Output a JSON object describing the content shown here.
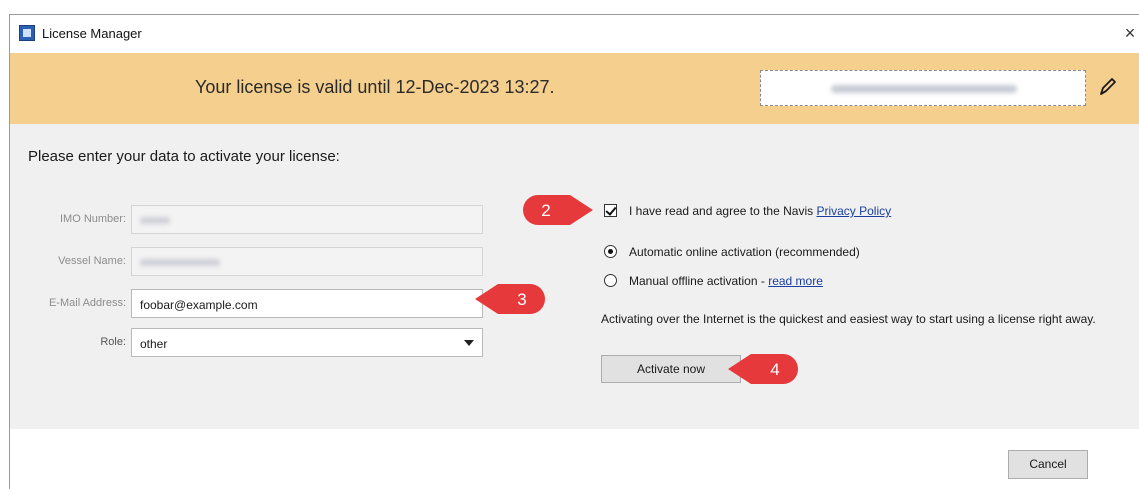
{
  "window": {
    "title": "License Manager",
    "close_label": "×"
  },
  "banner": {
    "text": "Your license is valid until 12-Dec-2023 13:27."
  },
  "form": {
    "intro": "Please enter your data to activate your license:",
    "imo_label": "IMO Number:",
    "vessel_label": "Vessel Name:",
    "email_label": "E-Mail Address:",
    "email_value": "foobar@example.com",
    "role_label": "Role:",
    "role_value": "other"
  },
  "activation": {
    "agree_prefix": "I have read and agree to the Navis ",
    "privacy_link": "Privacy Policy",
    "agree_checked": true,
    "auto_option": "Automatic online activation (recommended)",
    "manual_option": "Manual offline activation - ",
    "read_more": "read more",
    "selected": "auto",
    "description": "Activating over the Internet is the quickest and easiest way to start using a license right away.",
    "activate_button": "Activate now"
  },
  "footer": {
    "cancel_button": "Cancel"
  },
  "callouts": {
    "two": "2",
    "three": "3",
    "four": "4"
  },
  "colors": {
    "banner": "#f5cf8d",
    "callout": "#e5393b",
    "panel": "#f0f0f0"
  }
}
